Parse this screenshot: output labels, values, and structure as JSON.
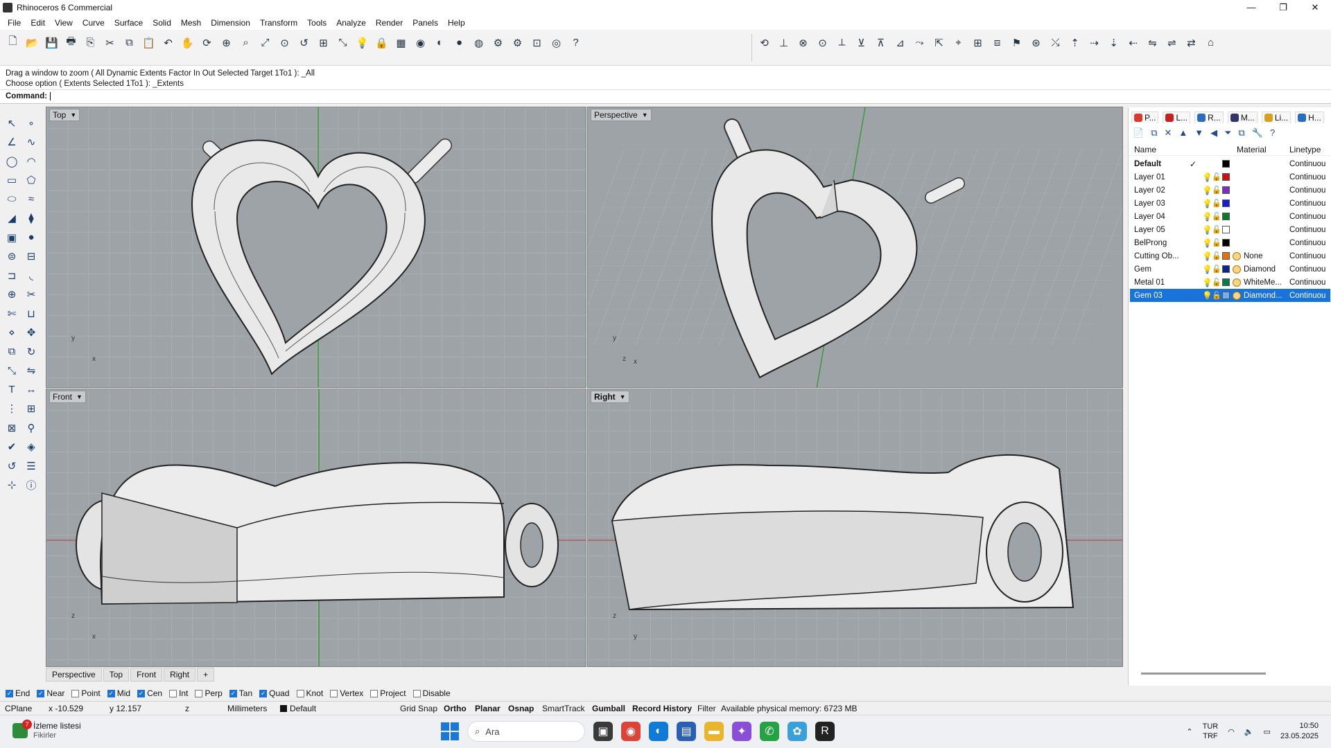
{
  "window": {
    "title": "Rhinoceros 6 Commercial",
    "controls": {
      "minimize": "—",
      "maximize": "❐",
      "close": "✕"
    }
  },
  "menu": [
    "File",
    "Edit",
    "View",
    "Curve",
    "Surface",
    "Solid",
    "Mesh",
    "Dimension",
    "Transform",
    "Tools",
    "Analyze",
    "Render",
    "Panels",
    "Help"
  ],
  "toolbar": {
    "left_icons": [
      "new-file-icon",
      "open-file-icon",
      "save-icon",
      "print-icon",
      "import-icon",
      "cut-icon",
      "copy-icon",
      "paste-icon",
      "undo-icon",
      "pan-icon",
      "rotate-view-icon",
      "zoom-icon",
      "zoom-window-icon",
      "zoom-extents-icon",
      "zoom-selected-icon",
      "zoom-previous-icon",
      "four-viewports-icon",
      "select-icon",
      "light-icon",
      "lock-icon",
      "shade-icon",
      "color-wheel-icon",
      "render-sphere-icon",
      "material-sphere-icon",
      "environment-sphere-icon",
      "options-icon",
      "gear-icon",
      "layout-icon",
      "globe-icon",
      "help-icon"
    ],
    "left_glyphs": [
      "🗋",
      "📂",
      "💾",
      "🖶",
      "⎘",
      "✂",
      "⧉",
      "📋",
      "↶",
      "✋",
      "⟳",
      "⊕",
      "⌕",
      "⤢",
      "⊙",
      "↺",
      "⊞",
      "⤡",
      "💡",
      "🔒",
      "▦",
      "◉",
      "◐",
      "●",
      "◍",
      "⚙",
      "⚙",
      "⊡",
      "◎",
      "?"
    ],
    "right_icons": [
      "transform-1-icon",
      "transform-2-icon",
      "transform-3-icon",
      "transform-4-icon",
      "transform-5-icon",
      "transform-6-icon",
      "transform-7-icon",
      "transform-8-icon",
      "transform-9-icon",
      "transform-10-icon",
      "transform-11-icon",
      "transform-12-icon",
      "transform-13-icon",
      "transform-14-icon",
      "transform-15-icon",
      "transform-16-icon",
      "transform-17-icon",
      "transform-18-icon",
      "transform-19-icon",
      "transform-20-icon",
      "transform-21-icon",
      "transform-22-icon",
      "transform-23-icon",
      "transform-24-icon"
    ],
    "right_glyphs": [
      "⟲",
      "⊥",
      "⊗",
      "⊙",
      "⟂",
      "⊻",
      "⊼",
      "⊿",
      "⤳",
      "⇱",
      "⌖",
      "⊞",
      "⧈",
      "⚑",
      "⊛",
      "⤯",
      "⇡",
      "⇢",
      "⇣",
      "⇠",
      "⇋",
      "⇌",
      "⇄",
      "⌂"
    ]
  },
  "command": {
    "history_1": "Drag a window to zoom ( All  Dynamic  Extents  Factor  In  Out  Selected  Target  1To1 ): _All",
    "history_2": "Choose option ( Extents  Selected  1To1 ): _Extents",
    "prompt": "Command:",
    "value": ""
  },
  "left_tools": [
    "select-icon",
    "point-icon",
    "polyline-icon",
    "curve-icon",
    "circle-icon",
    "arc-icon",
    "rectangle-icon",
    "polygon-icon",
    "ellipse-icon",
    "freeform-icon",
    "surface-icon",
    "loft-icon",
    "box-icon",
    "sphere-icon",
    "cylinder-icon",
    "extrude-icon",
    "offset-icon",
    "fillet-icon",
    "boolean-icon",
    "split-icon",
    "trim-icon",
    "join-icon",
    "explode-icon",
    "move-icon",
    "copy-icon",
    "rotate-icon",
    "scale-icon",
    "mirror-icon",
    "text-icon",
    "dimension-icon",
    "array-icon",
    "group-icon",
    "mesh-icon",
    "analyze-icon",
    "check-icon",
    "render-icon",
    "history-icon",
    "layers-icon",
    "gumball-icon",
    "properties-icon"
  ],
  "left_glyphs": [
    "↖",
    "∘",
    "∠",
    "∿",
    "◯",
    "◠",
    "▭",
    "⬠",
    "⬭",
    "≈",
    "◢",
    "⧫",
    "▣",
    "●",
    "⊜",
    "⊟",
    "⊐",
    "◟",
    "⊕",
    "✂",
    "✄",
    "⊔",
    "⋄",
    "✥",
    "⧉",
    "↻",
    "⤡",
    "⇋",
    "T",
    "↔",
    "⋮",
    "⊞",
    "⊠",
    "⚲",
    "✔",
    "◈",
    "↺",
    "☰",
    "⊹",
    "ⓘ"
  ],
  "viewports": {
    "top": {
      "label": "Top",
      "axis_y": "y",
      "axis_x": "x"
    },
    "perspective": {
      "label": "Perspective",
      "axis_y": "y",
      "axis_z": "z",
      "axis_x": "x"
    },
    "front": {
      "label": "Front",
      "axis_z": "z",
      "axis_x": "x"
    },
    "right": {
      "label": "Right",
      "axis_z": "z",
      "axis_y": "y"
    }
  },
  "viewport_tabs": [
    "Perspective",
    "Top",
    "Front",
    "Right",
    "+"
  ],
  "panel": {
    "tabs": [
      {
        "label": "P...",
        "color": "#d93a2b"
      },
      {
        "label": "L...",
        "color": "#c91f1f"
      },
      {
        "label": "R...",
        "color": "#2a6dbf"
      },
      {
        "label": "M...",
        "color": "#333366"
      },
      {
        "label": "Li...",
        "color": "#d6a21e"
      },
      {
        "label": "H...",
        "color": "#2a6dbf"
      }
    ],
    "tools": [
      "📄",
      "⧉",
      "✕",
      "▲",
      "▼",
      "◀",
      "⏷",
      "⧉",
      "🔧",
      "?"
    ],
    "col_name": "Name",
    "col_material": "Material",
    "col_linetype": "Linetype",
    "layers": [
      {
        "name": "Default",
        "current": "✓",
        "color": "#000000",
        "material": "",
        "linetype": "Continuou",
        "bold": true,
        "selected": false
      },
      {
        "name": "Layer 01",
        "current": "",
        "color": "#cc1111",
        "material": "",
        "linetype": "Continuou",
        "bold": false,
        "selected": false
      },
      {
        "name": "Layer 02",
        "current": "",
        "color": "#7b2fbf",
        "material": "",
        "linetype": "Continuou",
        "bold": false,
        "selected": false
      },
      {
        "name": "Layer 03",
        "current": "",
        "color": "#1a1ad9",
        "material": "",
        "linetype": "Continuou",
        "bold": false,
        "selected": false
      },
      {
        "name": "Layer 04",
        "current": "",
        "color": "#0a7a2a",
        "material": "",
        "linetype": "Continuou",
        "bold": false,
        "selected": false
      },
      {
        "name": "Layer 05",
        "current": "",
        "color": "#ffffff",
        "material": "",
        "linetype": "Continuou",
        "bold": false,
        "selected": false
      },
      {
        "name": "BelProng",
        "current": "",
        "color": "#000000",
        "material": "",
        "linetype": "Continuou",
        "bold": false,
        "selected": false
      },
      {
        "name": "Cutting Ob...",
        "current": "",
        "color": "#e07010",
        "material": "None",
        "linetype": "Continuou",
        "bold": false,
        "selected": false
      },
      {
        "name": "Gem",
        "current": "",
        "color": "#0a2a8a",
        "material": "Diamond",
        "linetype": "Continuou",
        "bold": false,
        "selected": false
      },
      {
        "name": "Metal 01",
        "current": "",
        "color": "#0a7a4a",
        "material": "WhiteMe...",
        "linetype": "Continuou",
        "bold": false,
        "selected": false
      },
      {
        "name": "Gem 03",
        "current": "",
        "color": "#6fb0ee",
        "material": "Diamond...",
        "linetype": "Continuou",
        "bold": false,
        "selected": true
      }
    ]
  },
  "osnap": [
    {
      "label": "End",
      "on": true
    },
    {
      "label": "Near",
      "on": true
    },
    {
      "label": "Point",
      "on": false
    },
    {
      "label": "Mid",
      "on": true
    },
    {
      "label": "Cen",
      "on": true
    },
    {
      "label": "Int",
      "on": false
    },
    {
      "label": "Perp",
      "on": false
    },
    {
      "label": "Tan",
      "on": true
    },
    {
      "label": "Quad",
      "on": true
    },
    {
      "label": "Knot",
      "on": false
    },
    {
      "label": "Vertex",
      "on": false
    },
    {
      "label": "Project",
      "on": false
    },
    {
      "label": "Disable",
      "on": false
    }
  ],
  "status": {
    "cplane": "CPlane",
    "x": "x -10.529",
    "y": "y 12.157",
    "z": "z",
    "units": "Millimeters",
    "layer": "Default",
    "grid_snap": "Grid Snap",
    "ortho": "Ortho",
    "planar": "Planar",
    "osnap": "Osnap",
    "smarttrack": "SmartTrack",
    "gumball": "Gumball",
    "record_history": "Record History",
    "filter": "Filter",
    "memory": "Available physical memory: 6723 MB"
  },
  "taskbar": {
    "watchlist_title": "İzleme listesi",
    "watchlist_sub": "Fikirler",
    "watchlist_badge": "7",
    "search_placeholder": "Ara",
    "language_1": "TUR",
    "language_2": "TRF",
    "time": "10:50",
    "date": "23.05.2025"
  }
}
